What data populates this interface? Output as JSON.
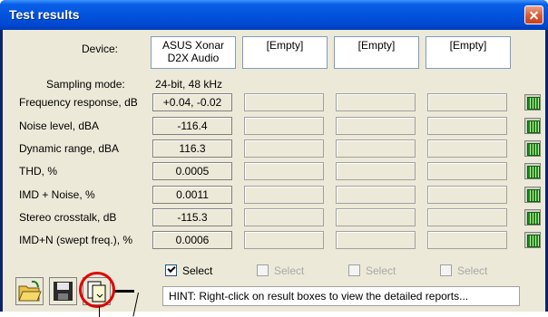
{
  "window": {
    "title": "Test results"
  },
  "device_label": "Device:",
  "devices": [
    {
      "name": "ASUS Xonar D2X Audio"
    },
    {
      "name": "[Empty]"
    },
    {
      "name": "[Empty]"
    },
    {
      "name": "[Empty]"
    }
  ],
  "sampling": {
    "label": "Sampling mode:",
    "value": "24-bit, 48 kHz"
  },
  "rows": [
    {
      "label": "Frequency response, dB",
      "value": "+0.04, -0.02"
    },
    {
      "label": "Noise level, dBA",
      "value": "-116.4"
    },
    {
      "label": "Dynamic range, dBA",
      "value": "116.3"
    },
    {
      "label": "THD, %",
      "value": "0.0005"
    },
    {
      "label": "IMD + Noise, %",
      "value": "0.0011"
    },
    {
      "label": "Stereo crosstalk, dB",
      "value": "-115.3"
    },
    {
      "label": "IMD+N (swept freq.), %",
      "value": "0.0006"
    }
  ],
  "select": [
    {
      "label": "Select",
      "checked": true
    },
    {
      "label": "Select",
      "checked": false
    },
    {
      "label": "Select",
      "checked": false
    },
    {
      "label": "Select",
      "checked": false
    }
  ],
  "hint": "HINT: Right-click on result boxes to view the detailed reports...",
  "icons": {
    "close": "close-icon",
    "open": "open-folder-icon",
    "save": "save-disk-icon",
    "report": "copy-report-icon",
    "grid": "grid-report-icon"
  },
  "colors": {
    "titlebar": "#0353dd",
    "client": "#ece9d8",
    "highlight_ring": "#e00000"
  }
}
